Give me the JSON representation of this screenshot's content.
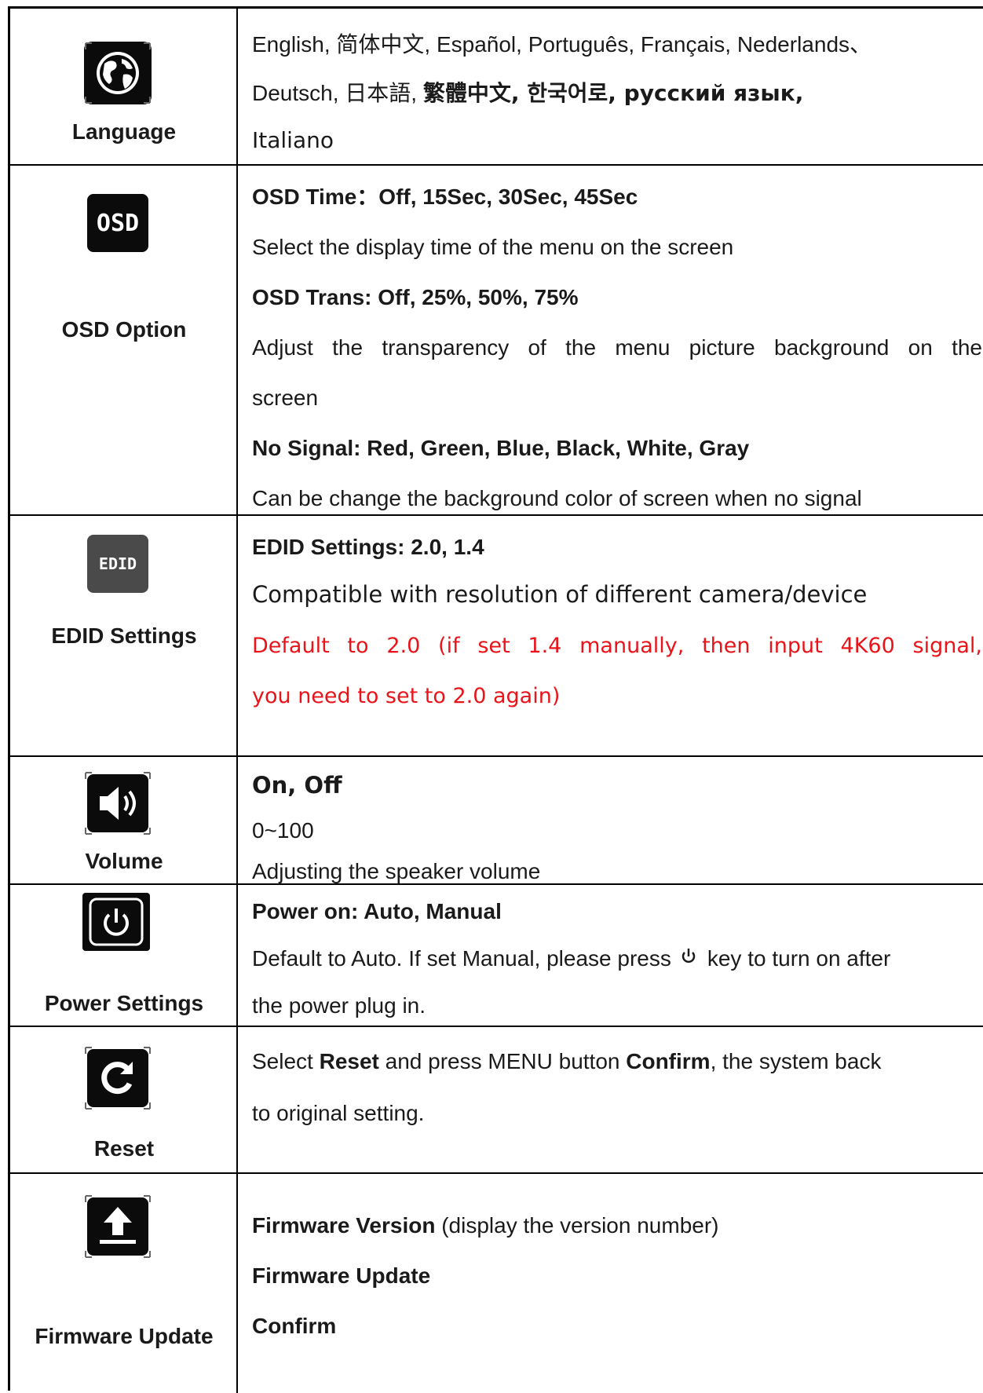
{
  "rows": {
    "language": {
      "label": "Language",
      "icon": "globe-icon",
      "line1": "English,  简体中文, Español, Português, Français, Nederlands、",
      "line2a": "Deutsch,  日本語,  ",
      "line2b": "繁體中文, 한국어로,  русский  язык,",
      "line3": "Italiano"
    },
    "osd": {
      "label": "OSD Option",
      "icon": "osd-icon",
      "icon_text": "OSD",
      "line1": "OSD Time：Off, 15Sec, 30Sec, 45Sec",
      "line2": "Select the display time of the menu on the screen",
      "line3": "OSD Trans: Off, 25%, 50%, 75%",
      "line4": "Adjust the transparency of the menu picture background on the",
      "line5": "screen",
      "line6": "No Signal: Red, Green, Blue, Black, White, Gray",
      "line7": "Can be change the background color of screen when no signal"
    },
    "edid": {
      "label": "EDID Settings",
      "icon": "edid-icon",
      "icon_text": "EDID",
      "line1": "EDID Settings: 2.0, 1.4",
      "line2": "Compatible with resolution of different camera/device",
      "line3": "Default to 2.0 (if set 1.4 manually, then input 4K60 signal,",
      "line4": "you need to set to 2.0 again)",
      "accent": "#e8141a"
    },
    "volume": {
      "label": "Volume",
      "icon": "speaker-icon",
      "line1": "On, Off",
      "line2": "0~100",
      "line3": "Adjusting the speaker volume"
    },
    "power": {
      "label": "Power Settings",
      "icon": "power-icon",
      "line1": "Power on: Auto, Manual",
      "line2a": "Default to Auto. If set Manual, please press",
      "line2b": "key to turn on after",
      "line3": "the power plug in."
    },
    "reset": {
      "label": "Reset",
      "icon": "reset-icon",
      "line1a": "Select ",
      "line1b": "Reset",
      "line1c": " and press MENU button ",
      "line1d": "Confirm",
      "line1e": ", the system back",
      "line2": "to original setting."
    },
    "firmware": {
      "label": "Firmware Update",
      "icon": "upload-icon",
      "line1a": "Firmware Version",
      "line1b": " (display the version number)",
      "line2": "Firmware Update",
      "line3": "Confirm"
    }
  }
}
